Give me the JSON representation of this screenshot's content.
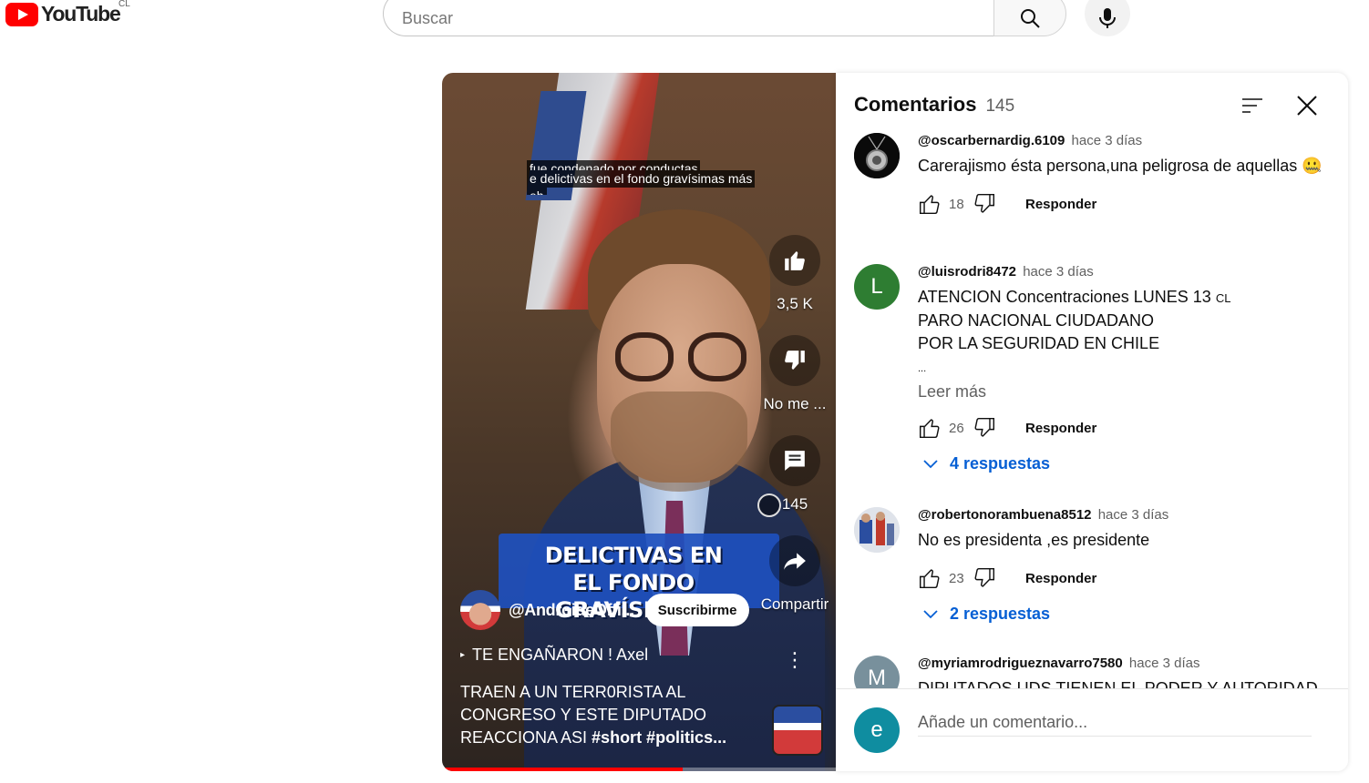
{
  "header": {
    "logo_text": "YouTube",
    "country": "CL",
    "search_placeholder": "Buscar"
  },
  "video": {
    "subtitle_lines": [
      "fue condenado por conductas",
      "e delictivas en el fondo gravísimas más",
      "eh"
    ],
    "caption_lines": [
      "DELICTIVAS EN",
      "EL FONDO GRAVÍSIMAS,"
    ],
    "likes": "3,5 K",
    "dislike_label": "No me ...",
    "comments": "145",
    "share_label": "Compartir",
    "channel": "@AndroideOffi...",
    "subscribe_label": "Suscribirme",
    "sound": "TE ENGAÑARON ! Axel",
    "title_plain": "TRAEN A UN TERR0RISTA AL CONGRESO Y ESTE DIPUTADO REACCIONA ASI ",
    "title_tags": "#short #politics...",
    "progress": 0.61
  },
  "comments_panel": {
    "title": "Comentarios",
    "count": "145",
    "comments": [
      {
        "author": "@oscarbernardig.6109",
        "time": "hace 3 días",
        "text": "Carerajismo ésta persona,una peligrosa de aquellas 🤐",
        "likes": "18",
        "reply": "Responder"
      },
      {
        "author": "@luisrodri8472",
        "time": "hace 3 días",
        "avatar_letter": "L",
        "text_line1": "ATENCION Concentraciones LUNES 13",
        "text_flag": "CL",
        "text_line2": "PARO NACIONAL CIUDADANO",
        "text_line3": "POR LA SEGURIDAD EN CHILE",
        "ellipsis": "...",
        "read_more": "Leer más",
        "likes": "26",
        "reply": "Responder",
        "replies": "4 respuestas"
      },
      {
        "author": "@robertonorambuena8512",
        "time": "hace 3 días",
        "text": "No es presidenta ,es presidente",
        "likes": "23",
        "reply": "Responder",
        "replies": "2 respuestas"
      },
      {
        "author": "@myriamrodrigueznavarro7580",
        "time": "hace 3 días",
        "avatar_letter": "M",
        "text": "DIPUTADOS UDS TIENEN EL PODER Y AUTORIDAD"
      }
    ],
    "composer_avatar": "e",
    "composer_placeholder": "Añade un comentario..."
  },
  "colors": {
    "brand_red": "#ff0000",
    "link_blue": "#065fd4",
    "avatar_green": "#2e7d32",
    "avatar_teal": "#0f8da0",
    "avatar_gray": "#78909c"
  }
}
